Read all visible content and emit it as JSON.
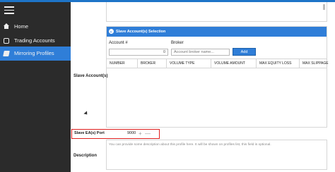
{
  "sidebar": {
    "items": [
      {
        "label": "Home",
        "icon": "home-icon",
        "active": false
      },
      {
        "label": "Trading Accounts",
        "icon": "accounts-icon",
        "active": false
      },
      {
        "label": "Mirroring Profiles",
        "icon": "mirroring-icon",
        "active": true
      }
    ]
  },
  "slave_accounts": {
    "section_label": "Slave Account(s)",
    "panel_title": "Slave Account(s) Selection",
    "account_label": "Account #",
    "account_value": "0",
    "broker_label": "Broker",
    "broker_placeholder": "Account broker name...",
    "add_label": "Add",
    "columns": [
      "NUMBER",
      "BROKER",
      "VOLUME TYPE",
      "VOLUME AMOUNT",
      "MAX EQUITY LOSS",
      "MAX SLIPPAGE"
    ]
  },
  "port": {
    "label": "Slave EA(s) Port",
    "value": "9000",
    "plus": "+",
    "minus": "—"
  },
  "description": {
    "label": "Description",
    "placeholder": "You can provide some description about this profile here. It will be shown on profiles list, this field is optional."
  },
  "colors": {
    "accent": "#2f7ed8",
    "sidebar_bg": "#2b2b2b",
    "highlight": "#e0201f"
  }
}
